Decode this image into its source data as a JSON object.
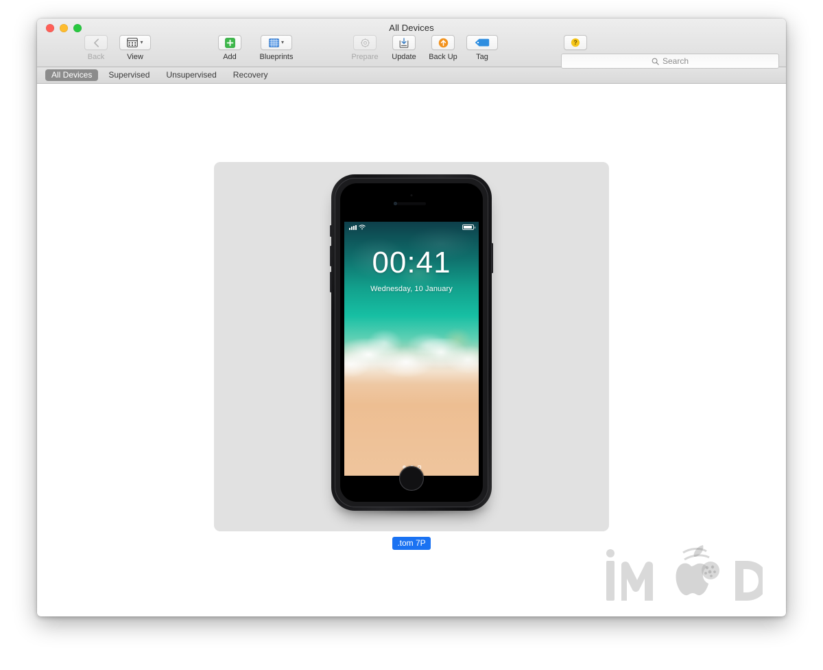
{
  "window": {
    "title": "All Devices",
    "traffic_lights": [
      {
        "name": "close",
        "color": "#ff5f57"
      },
      {
        "name": "minimize",
        "color": "#febc2e"
      },
      {
        "name": "zoom",
        "color": "#28c840"
      }
    ]
  },
  "toolbar": {
    "items": [
      {
        "id": "back",
        "label": "Back",
        "icon": "chevron-left-icon",
        "enabled": false,
        "has_chevron": false
      },
      {
        "id": "view",
        "label": "View",
        "icon": "view-grid-icon",
        "enabled": true,
        "has_chevron": true
      },
      {
        "id": "add",
        "label": "Add",
        "icon": "plus-green-icon",
        "enabled": true,
        "has_chevron": false
      },
      {
        "id": "blueprints",
        "label": "Blueprints",
        "icon": "blueprint-icon",
        "enabled": true,
        "has_chevron": true
      },
      {
        "id": "prepare",
        "label": "Prepare",
        "icon": "gear-icon",
        "enabled": false,
        "has_chevron": false
      },
      {
        "id": "update",
        "label": "Update",
        "icon": "download-box-icon",
        "enabled": true,
        "has_chevron": false
      },
      {
        "id": "backup",
        "label": "Back Up",
        "icon": "arrow-up-circle-icon",
        "enabled": true,
        "has_chevron": false
      },
      {
        "id": "tag",
        "label": "Tag",
        "icon": "tag-blue-icon",
        "enabled": true,
        "has_chevron": false
      },
      {
        "id": "help",
        "label": "Help",
        "icon": "question-circle-icon",
        "enabled": true,
        "has_chevron": false
      }
    ],
    "colors": {
      "add_green": "#3db84a",
      "blueprint_blue": "#4a90e2",
      "backup_orange": "#f2921d",
      "tag_blue": "#2f8ee0",
      "help_yellow": "#f5c518"
    }
  },
  "search": {
    "placeholder": "Search",
    "value": "",
    "icon": "search-icon"
  },
  "filters": {
    "items": [
      {
        "id": "all-devices",
        "label": "All Devices",
        "active": true
      },
      {
        "id": "supervised",
        "label": "Supervised",
        "active": false
      },
      {
        "id": "unsupervised",
        "label": "Unsupervised",
        "active": false
      },
      {
        "id": "recovery",
        "label": "Recovery",
        "active": false
      }
    ],
    "active_color": "#8b8b8b"
  },
  "devices": [
    {
      "name": ".tom 7P",
      "selected": true,
      "selection_color": "#1a72f2",
      "tile_background": "#e1e1e1",
      "screen": {
        "clock": "00:41",
        "date": "Wednesday, 10 January",
        "wallpaper": "ios11-beach",
        "status_bar": {
          "signal_icon": "cellular-bars-icon",
          "wifi_icon": "wifi-icon",
          "battery_icon": "battery-icon"
        },
        "page_dots": 3,
        "active_dot_index": 1
      }
    }
  ],
  "watermark": {
    "text_left": "iM",
    "text_right": "D",
    "apple_icon": "apple-logo-icon",
    "color": "#828282"
  }
}
